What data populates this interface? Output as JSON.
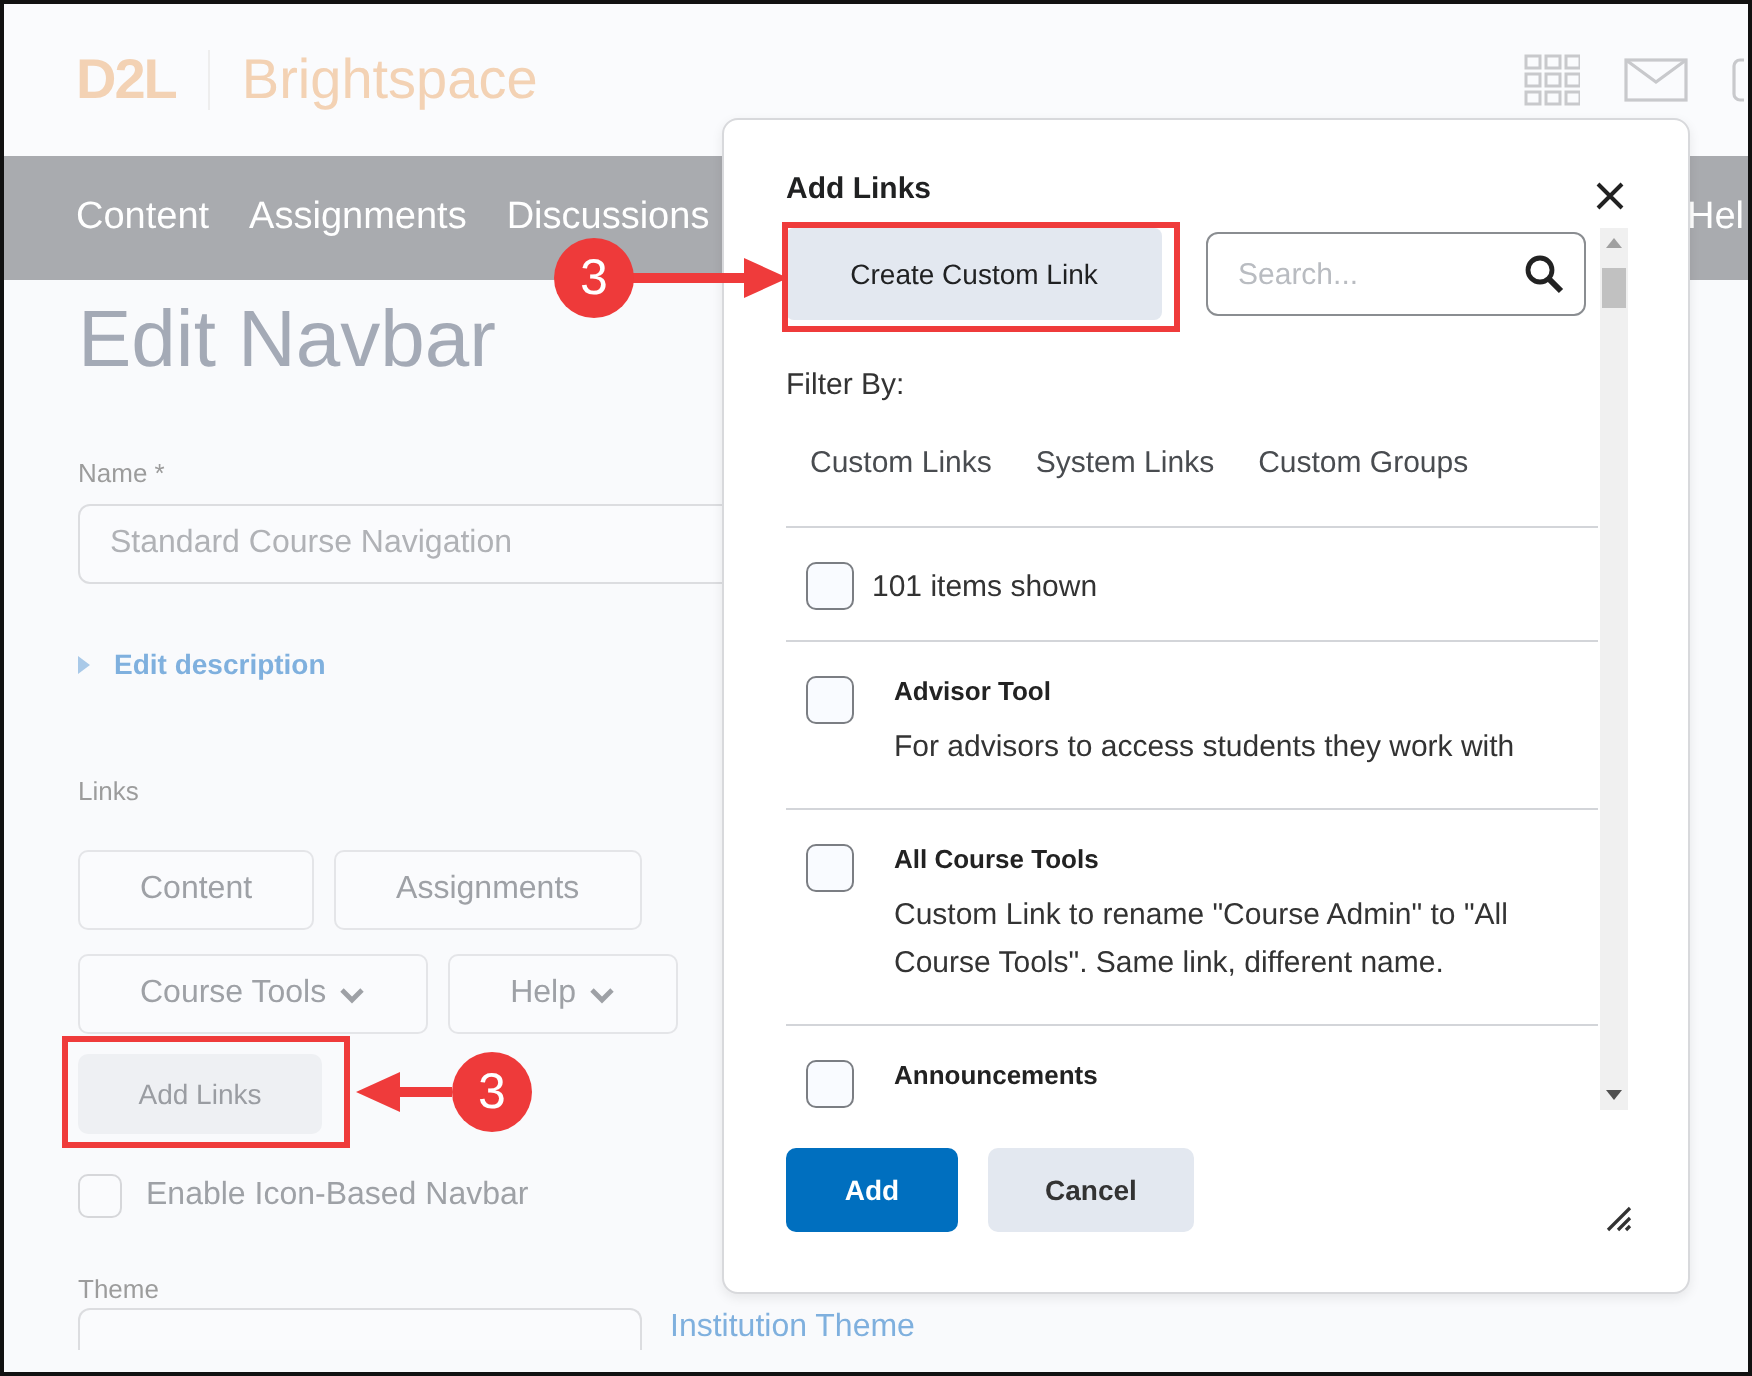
{
  "header": {
    "logo": "D2L",
    "brand": "Brightspace"
  },
  "nav": [
    "Content",
    "Assignments",
    "Discussions",
    "Hel"
  ],
  "page": {
    "title": "Edit Navbar",
    "name_label": "Name *",
    "name_value": "Standard Course Navigation",
    "edit_description": "Edit description",
    "links_label": "Links",
    "link_rows": [
      [
        {
          "label": "Content",
          "dropdown": false
        },
        {
          "label": "Assignments",
          "dropdown": false
        }
      ],
      [
        {
          "label": "Course Tools",
          "dropdown": true
        },
        {
          "label": "Help",
          "dropdown": true
        }
      ]
    ],
    "add_links": "Add Links",
    "icon_navbar": {
      "label": "Enable Icon-Based Navbar",
      "checked": false
    },
    "theme_label": "Theme",
    "theme_link": "Institution Theme"
  },
  "dialog": {
    "title": "Add Links",
    "create_button": "Create Custom Link",
    "search": {
      "placeholder": "Search..."
    },
    "filter_label": "Filter By:",
    "filters": [
      {
        "label": "Custom Links",
        "selected": false
      },
      {
        "label": "System Links",
        "selected": false
      },
      {
        "label": "Custom Groups",
        "selected": false
      }
    ],
    "select_all": {
      "label": "101 items shown",
      "checked": false
    },
    "items": [
      {
        "title": "Advisor Tool",
        "description": "For advisors to access students they work with",
        "checked": false
      },
      {
        "title": "All Course Tools",
        "description": "Custom Link to rename \"Course Admin\" to \"All Course Tools\". Same link, different name.",
        "checked": false
      },
      {
        "title": "Announcements",
        "checked": false
      }
    ],
    "buttons": [
      {
        "label": "Add",
        "kind": "primary"
      },
      {
        "label": "Cancel",
        "kind": "secondary"
      }
    ]
  },
  "annotations": [
    {
      "number": "3",
      "kind": "right"
    },
    {
      "number": "3",
      "kind": "left"
    }
  ]
}
